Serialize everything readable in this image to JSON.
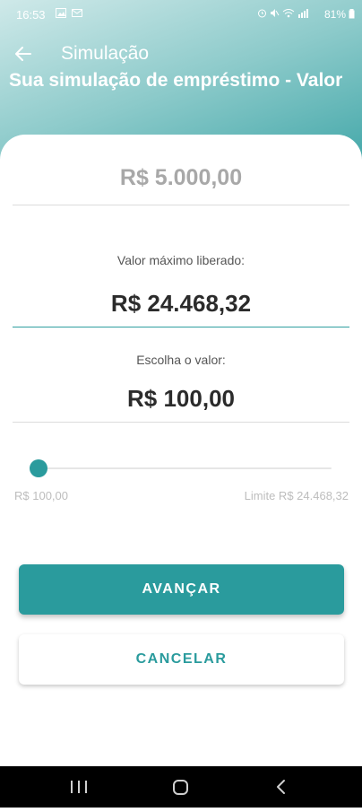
{
  "status_bar": {
    "time": "16:53",
    "left_icons": [
      "image-icon",
      "mail-icon"
    ],
    "right_text": "81%",
    "right_icons": [
      "alarm-icon",
      "mute-icon",
      "wifi-icon",
      "signal-icon",
      "battery-icon"
    ]
  },
  "appbar": {
    "back_icon": "arrow-left-icon",
    "title": "Simulação"
  },
  "page": {
    "title": "Sua simulação de empréstimo - Valor"
  },
  "form": {
    "amount_value": "R$ 5.000,00",
    "max_label": "Valor máximo liberado:",
    "max_value": "R$ 24.468,32",
    "choose_label": "Escolha o valor:",
    "choose_value": "R$ 100,00",
    "slider": {
      "min_label": "R$ 100,00",
      "max_label": "Limite R$ 24.468,32",
      "level_fraction": 0.0
    }
  },
  "buttons": {
    "primary": "AVANÇAR",
    "secondary": "CANCELAR"
  },
  "nav": {
    "icons": [
      "recent-apps-icon",
      "home-icon",
      "back-icon"
    ]
  },
  "colors": {
    "accent": "#2a9b9d",
    "header_light": "#cfe9e9",
    "header_dark": "#2f9ea0"
  }
}
